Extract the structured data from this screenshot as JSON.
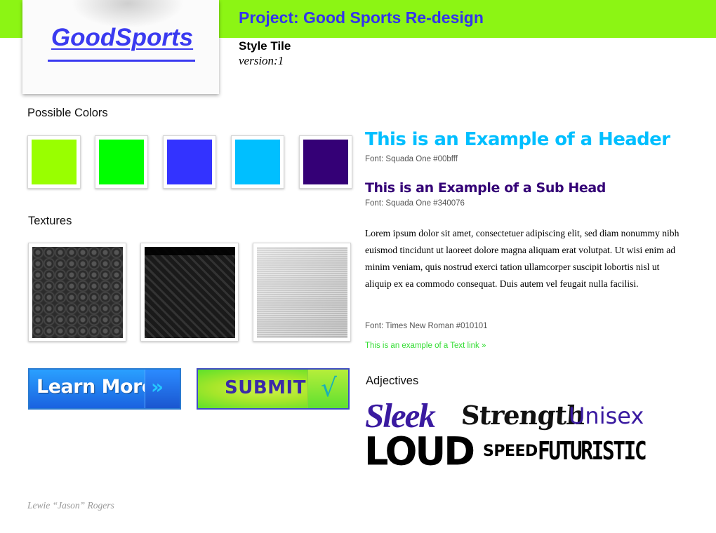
{
  "logo": {
    "text": "GoodSports"
  },
  "header": {
    "project_title": "Project: Good Sports Re-design",
    "tile_title": "Style Tile",
    "version": "version:1"
  },
  "colors_section": {
    "label": "Possible Colors",
    "swatches": [
      "#99ff00",
      "#00ff00",
      "#3333ff",
      "#00bfff",
      "#340076"
    ]
  },
  "textures_section": {
    "label": "Textures"
  },
  "buttons": {
    "learn_more": "Learn More",
    "learn_more_arrow": "»",
    "submit": "SUBMIT",
    "submit_check": "√"
  },
  "typography": {
    "header_example": "This is an Example of a Header",
    "header_font_note": "Font: Squada One  #00bfff",
    "subhead_example": "This is an Example of a Sub Head",
    "subhead_font_note": "Font: Squada One #340076",
    "body_text": "Lorem ipsum dolor sit amet, consectetuer adipiscing elit, sed diam nonummy nibh euismod tincidunt ut laoreet dolore magna aliquam erat volutpat. Ut wisi enim ad minim veniam, quis nostrud exerci tation ullamcorper suscipit lobortis nisl ut aliquip ex ea commodo consequat. Duis autem vel feugait nulla facilisi.",
    "body_font_note": "Font: Times New Roman #010101",
    "text_link": "This is an example of a Text link »"
  },
  "adjectives_section": {
    "label": "Adjectives",
    "words": [
      "Sleek",
      "Strength",
      "Unisex",
      "LOUD",
      "SPEED",
      "FUTURISTIC"
    ]
  },
  "author": "Lewie “Jason” Rogers"
}
